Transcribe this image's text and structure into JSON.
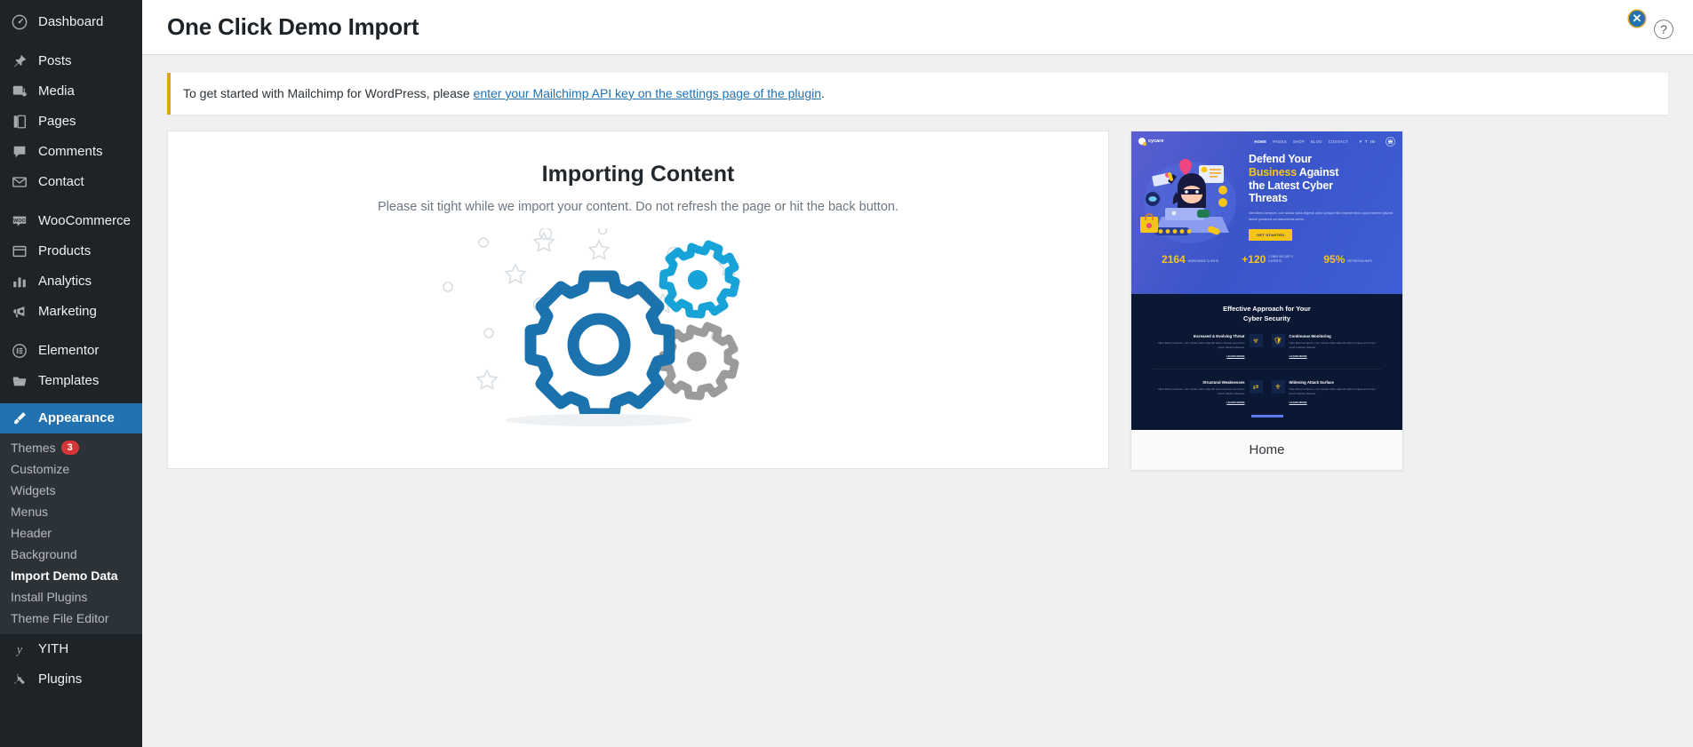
{
  "sidebar": {
    "items": [
      {
        "label": "Dashboard",
        "icon": "dashboard-icon"
      },
      {
        "label": "Posts",
        "icon": "pin-icon"
      },
      {
        "label": "Media",
        "icon": "media-icon"
      },
      {
        "label": "Pages",
        "icon": "pages-icon"
      },
      {
        "label": "Comments",
        "icon": "comments-icon"
      },
      {
        "label": "Contact",
        "icon": "envelope-icon"
      },
      {
        "label": "WooCommerce",
        "icon": "woocommerce-icon"
      },
      {
        "label": "Products",
        "icon": "products-icon"
      },
      {
        "label": "Analytics",
        "icon": "analytics-icon"
      },
      {
        "label": "Marketing",
        "icon": "megaphone-icon"
      },
      {
        "label": "Elementor",
        "icon": "elementor-icon"
      },
      {
        "label": "Templates",
        "icon": "folder-icon"
      },
      {
        "label": "Appearance",
        "icon": "brush-icon"
      },
      {
        "label": "YITH",
        "icon": "yith-icon"
      },
      {
        "label": "Plugins",
        "icon": "plug-icon"
      }
    ],
    "appearance_submenu": [
      {
        "label": "Themes",
        "badge": "3"
      },
      {
        "label": "Customize",
        "badge": ""
      },
      {
        "label": "Widgets",
        "badge": ""
      },
      {
        "label": "Menus",
        "badge": ""
      },
      {
        "label": "Header",
        "badge": ""
      },
      {
        "label": "Background",
        "badge": ""
      },
      {
        "label": "Import Demo Data",
        "badge": ""
      },
      {
        "label": "Install Plugins",
        "badge": ""
      },
      {
        "label": "Theme File Editor",
        "badge": ""
      }
    ]
  },
  "header": {
    "title": "One Click Demo Import",
    "help_icon": "?",
    "close_icon": "✕"
  },
  "notice": {
    "text_before": "To get started with Mailchimp for WordPress, please ",
    "link_text": "enter your Mailchimp API key on the settings page of the plugin",
    "text_after": ".",
    "accent_color": "#dba617"
  },
  "import": {
    "title": "Importing Content",
    "subtitle": "Please sit tight while we import your content. Do not refresh the page or hit the back button.",
    "graphic": "gears-illustration"
  },
  "preview": {
    "label": "Home",
    "logo": "cycare",
    "nav": [
      "HOME",
      "PAGES",
      "SHOP",
      "BLOG",
      "CONTACT"
    ],
    "headline_line1": "Defend Your",
    "headline_highlight": "Business",
    "headline_line2_rest": " Against",
    "headline_line3": "the Latest Cyber",
    "headline_line4": "Threats",
    "paragraph": "Nam libero tempore, cum soluta nobis eligendi optio cumque nihil impedit minus quod maxime placeat facere possimus cui assumenda omnis.",
    "cta": "GET STARTED",
    "stats": [
      {
        "value": "2164",
        "label": "WORLDWIDE CLIENTS"
      },
      {
        "value": "+120",
        "label": "CYBER SECURITY EXPERTS"
      },
      {
        "value": "95%",
        "label": "RETENTION RATE"
      }
    ],
    "section_title_line1": "Effective Approach for Your",
    "section_title_line2": "Cyber Security",
    "features": [
      {
        "title": "Increased & Evolving Threat",
        "text": "Nam libero tempore, cum soluta nobis eligendi optio cumque qui minus quod maxime placeat.",
        "link": "LEARN MORE",
        "icon": "hacker-icon"
      },
      {
        "title": "Continuous Monitoring",
        "text": "Nam libero tempore, cum soluta nobis eligendi optio cumque qui minus quod maxime placeat.",
        "link": "LEARN MORE",
        "icon": "shield-icon"
      },
      {
        "title": "Structural Weaknesses",
        "text": "Nam libero tempore, cum soluta nobis eligendi optio cumque qui minus quod maxime placeat.",
        "link": "LEARN MORE",
        "icon": "network-icon"
      },
      {
        "title": "Widening Attack Surface",
        "text": "Nam libero tempore, cum soluta nobis eligendi optio cumque qui minus quod maxime placeat.",
        "link": "LEARN MORE",
        "icon": "badge-icon"
      }
    ]
  },
  "colors": {
    "sidebar_bg": "#1d2327",
    "sidebar_active": "#2271b1",
    "notice_accent": "#dba617",
    "gear_blue": "#1b72ad",
    "gear_cyan": "#18a3d8",
    "gear_gray": "#9b9b9b",
    "preview_yellow": "#f5c518"
  }
}
